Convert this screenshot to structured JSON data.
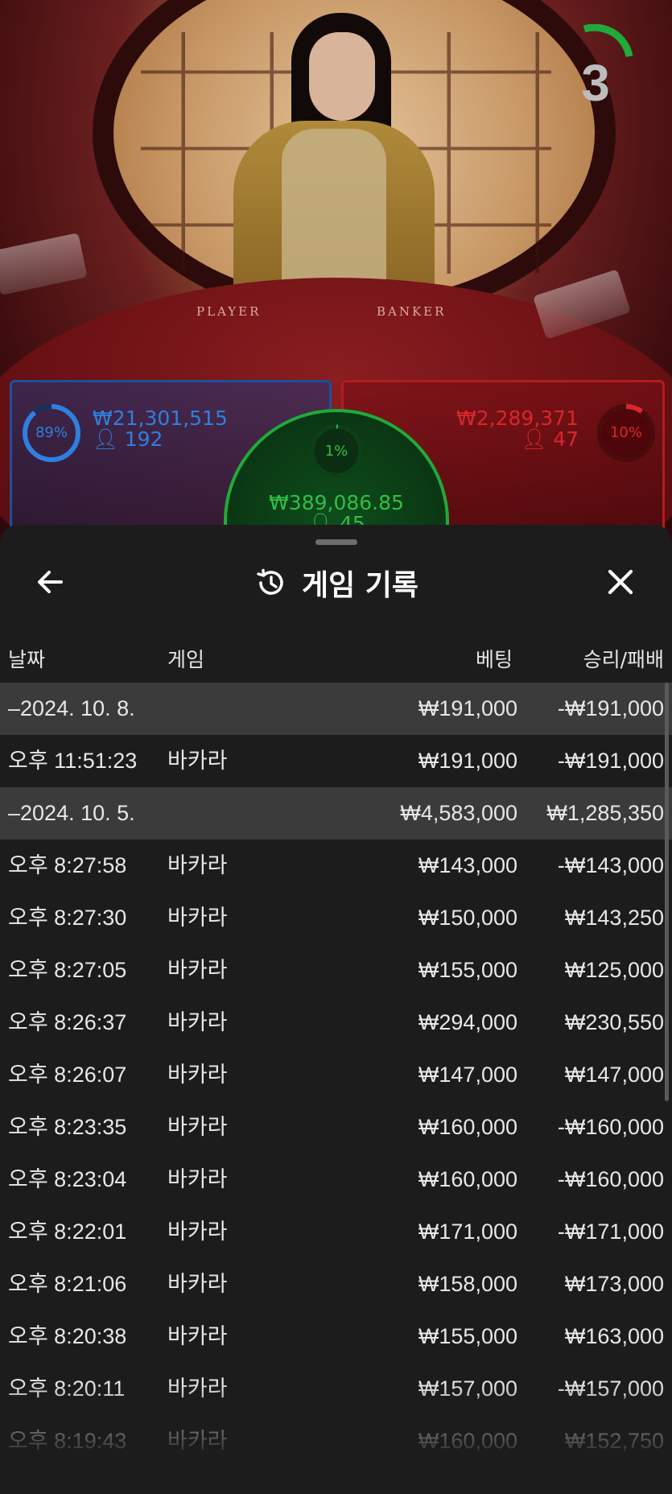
{
  "countdown": {
    "value": "3",
    "ring_color": "#1faa3b"
  },
  "table_labels": {
    "player": "PLAYER",
    "banker": "BANKER"
  },
  "bets": {
    "player": {
      "percent": "89%",
      "amount": "₩21,301,515",
      "count": "192",
      "color": "#2f7fe0"
    },
    "banker": {
      "percent": "10%",
      "amount": "₩2,289,371",
      "count": "47",
      "color": "#d9262c"
    },
    "tie": {
      "percent": "1%",
      "amount": "₩389,086.85",
      "count": "45",
      "color": "#2fbf45"
    }
  },
  "sheet": {
    "title": "게임 기록",
    "icons": {
      "back": "arrow-left-icon",
      "history": "history-icon",
      "close": "close-icon"
    },
    "columns": {
      "date": "날짜",
      "game": "게임",
      "bet": "베팅",
      "winloss": "승리/패배"
    },
    "rows": [
      {
        "type": "group",
        "date": "–2024. 10. 8.",
        "game": "",
        "bet": "₩191,000",
        "winloss": "-₩191,000"
      },
      {
        "type": "item",
        "date": "오후 11:51:23",
        "game": "바카라",
        "bet": "₩191,000",
        "winloss": "-₩191,000"
      },
      {
        "type": "group",
        "date": "–2024. 10. 5.",
        "game": "",
        "bet": "₩4,583,000",
        "winloss": "₩1,285,350"
      },
      {
        "type": "item",
        "date": "오후 8:27:58",
        "game": "바카라",
        "bet": "₩143,000",
        "winloss": "-₩143,000"
      },
      {
        "type": "item",
        "date": "오후 8:27:30",
        "game": "바카라",
        "bet": "₩150,000",
        "winloss": "₩143,250"
      },
      {
        "type": "item",
        "date": "오후 8:27:05",
        "game": "바카라",
        "bet": "₩155,000",
        "winloss": "₩125,000"
      },
      {
        "type": "item",
        "date": "오후 8:26:37",
        "game": "바카라",
        "bet": "₩294,000",
        "winloss": "₩230,550"
      },
      {
        "type": "item",
        "date": "오후 8:26:07",
        "game": "바카라",
        "bet": "₩147,000",
        "winloss": "₩147,000"
      },
      {
        "type": "item",
        "date": "오후 8:23:35",
        "game": "바카라",
        "bet": "₩160,000",
        "winloss": "-₩160,000"
      },
      {
        "type": "item",
        "date": "오후 8:23:04",
        "game": "바카라",
        "bet": "₩160,000",
        "winloss": "-₩160,000"
      },
      {
        "type": "item",
        "date": "오후 8:22:01",
        "game": "바카라",
        "bet": "₩171,000",
        "winloss": "-₩171,000"
      },
      {
        "type": "item",
        "date": "오후 8:21:06",
        "game": "바카라",
        "bet": "₩158,000",
        "winloss": "₩173,000"
      },
      {
        "type": "item",
        "date": "오후 8:20:38",
        "game": "바카라",
        "bet": "₩155,000",
        "winloss": "₩163,000"
      },
      {
        "type": "item",
        "date": "오후 8:20:11",
        "game": "바카라",
        "bet": "₩157,000",
        "winloss": "-₩157,000"
      },
      {
        "type": "item",
        "date": "오후 8:19:43",
        "game": "바카라",
        "bet": "₩160,000",
        "winloss": "₩152,750"
      }
    ]
  }
}
